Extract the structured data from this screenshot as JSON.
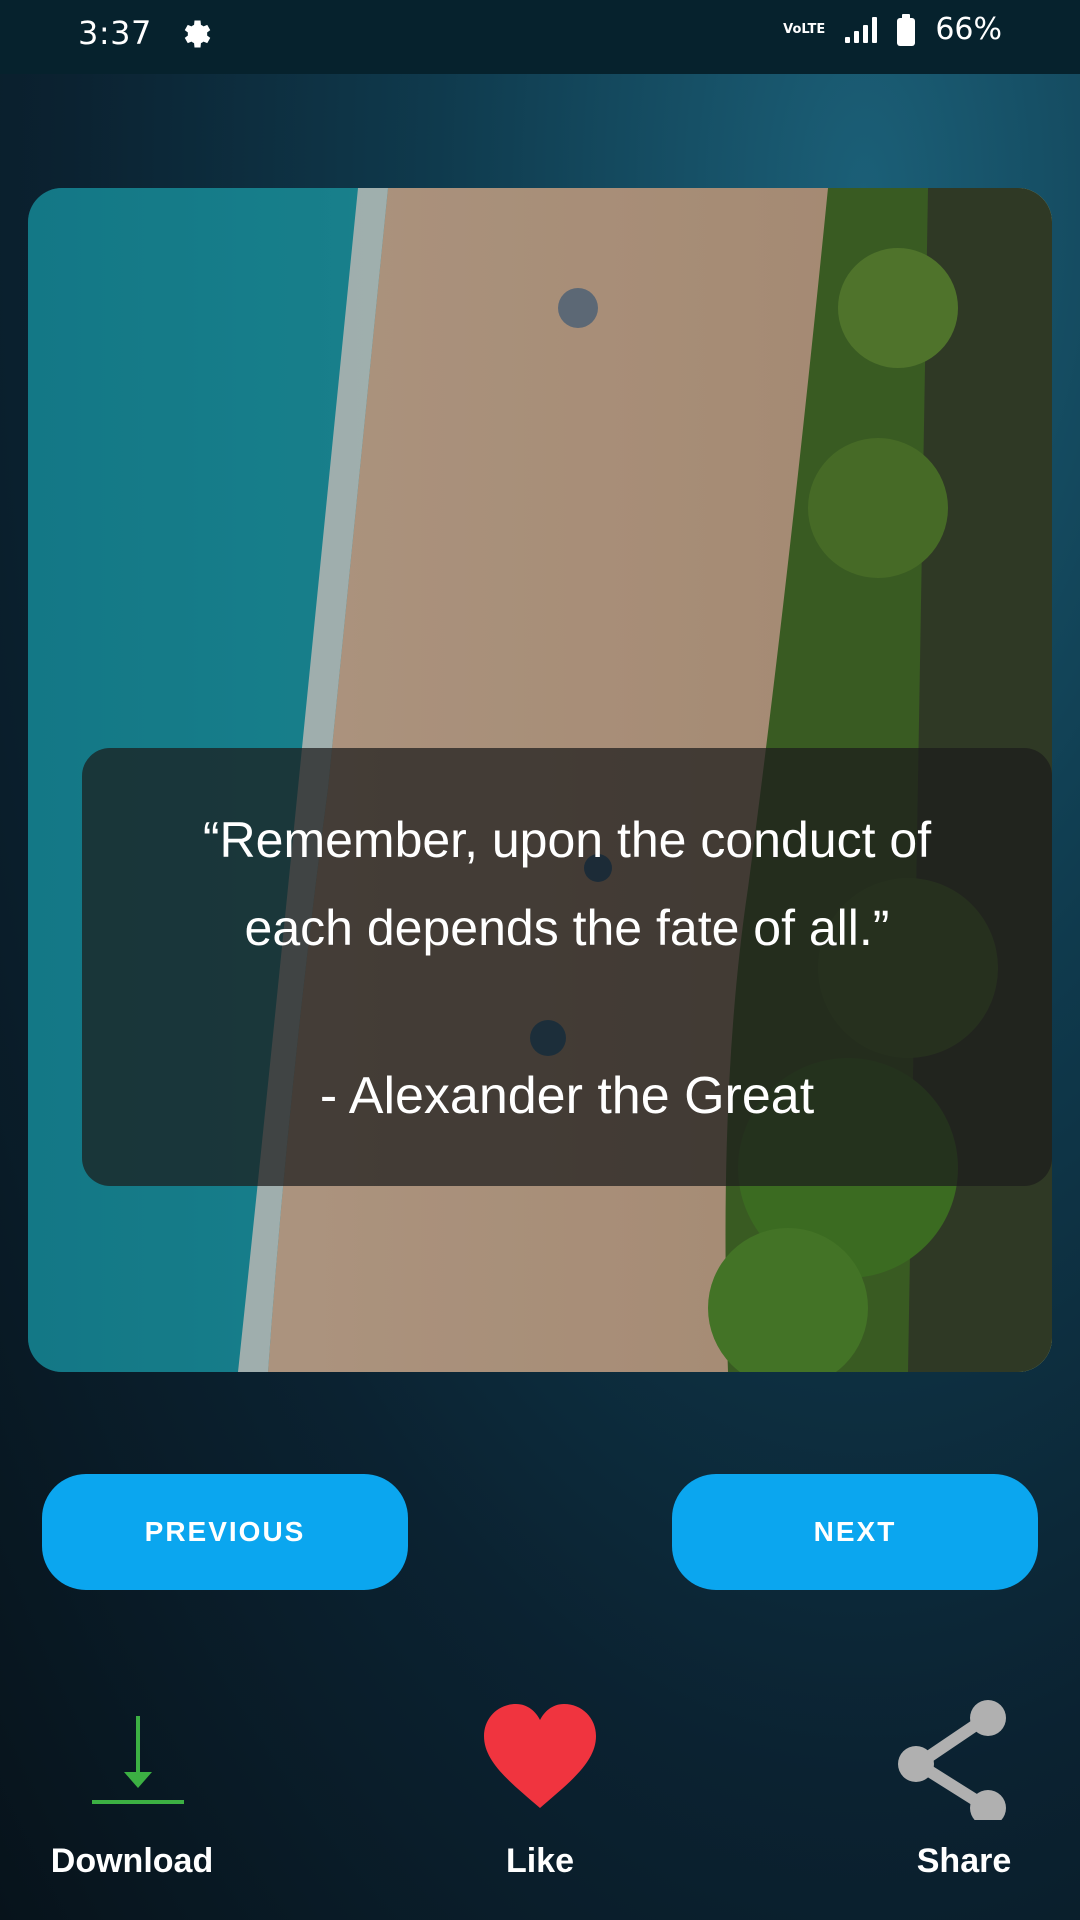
{
  "status_bar": {
    "time": "3:37",
    "network_label": "VoLTE",
    "battery_percent": "66%",
    "icons": [
      "settings-gear-icon",
      "volte-icon",
      "signal-icon",
      "battery-icon"
    ]
  },
  "quote": {
    "text": "“Remember, upon the conduct of each depends the fate of all.”",
    "author": "- Alexander the Great"
  },
  "navigation": {
    "previous_label": "PREVIOUS",
    "next_label": "NEXT"
  },
  "actions": {
    "download_label": "Download",
    "like_label": "Like",
    "share_label": "Share",
    "icons": [
      "download-icon",
      "heart-icon",
      "share-icon"
    ]
  },
  "colors": {
    "button": "#0BA6EF",
    "like_heart": "#F0343F",
    "download_icon": "#3CB043",
    "share_icon": "#B0B0B0"
  }
}
